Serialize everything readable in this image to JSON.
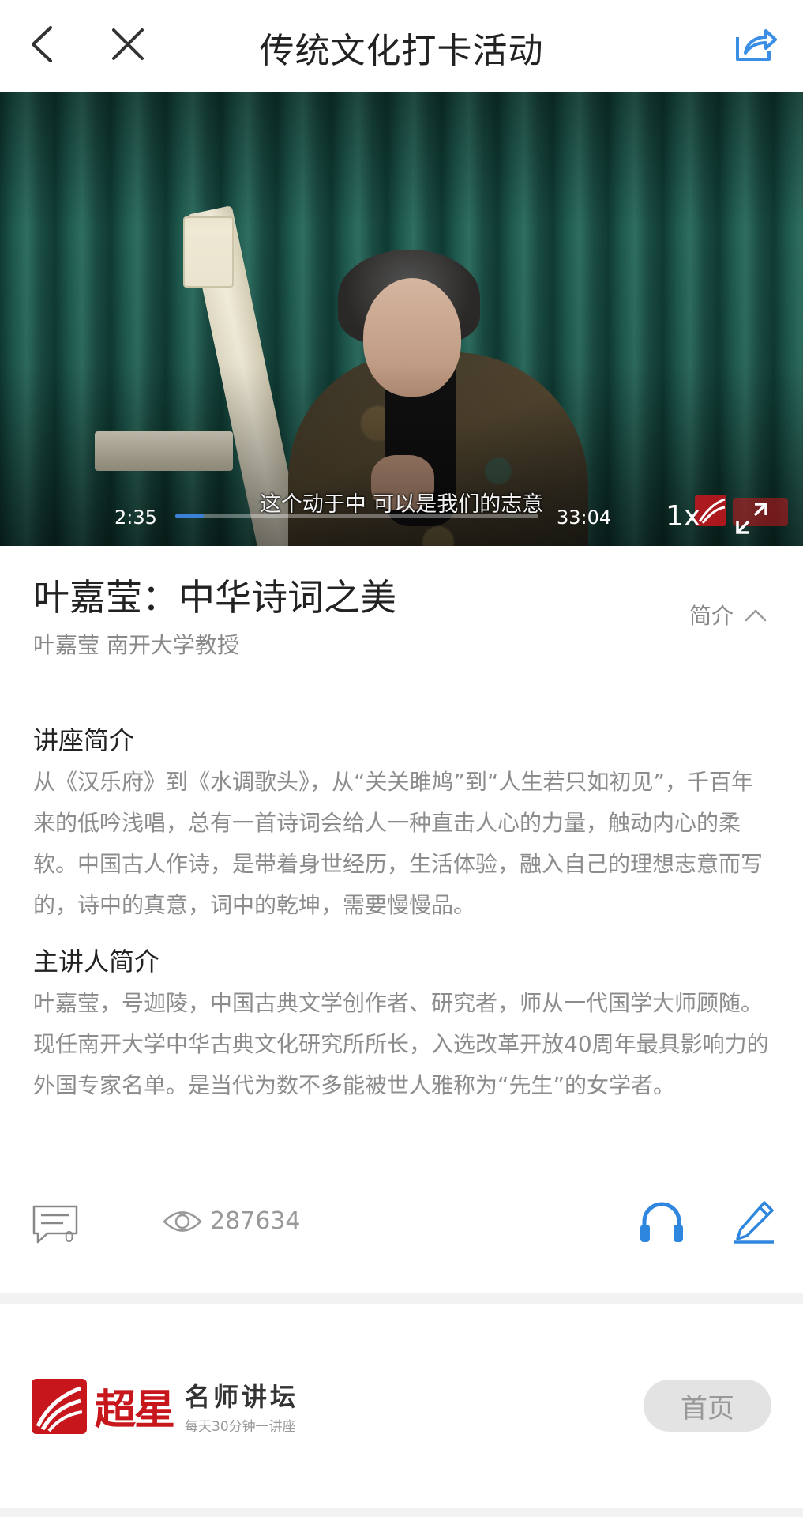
{
  "header": {
    "title": "传统文化打卡活动",
    "back_icon": "back-chevron-icon",
    "close_icon": "close-icon",
    "share_icon": "share-icon",
    "accent_color": "#3a8ee6"
  },
  "video": {
    "subtitle": "这个动于中  可以是我们的志意",
    "current_time": "2:35",
    "total_time": "33:04",
    "progress_fraction": 0.078,
    "speed": "1x",
    "fullscreen_icon": "fullscreen-icon"
  },
  "lecture": {
    "title": "叶嘉莹：中华诗词之美",
    "author": "叶嘉莹  南开大学教授",
    "intro_toggle_label": "简介"
  },
  "sections": {
    "lecture_intro_heading": "讲座简介",
    "lecture_intro_text": "从《汉乐府》到《水调歌头》，从“关关雎鸠”到“人生若只如初见”，千百年来的低吟浅唱，总有一首诗词会给人一种直击人心的力量，触动内心的柔软。中国古人作诗，是带着身世经历，生活体验，融入自己的理想志意而写的，诗中的真意，词中的乾坤，需要慢慢品。",
    "speaker_intro_heading": "主讲人简介",
    "speaker_intro_text": "叶嘉莹，号迦陵，中国古典文学创作者、研究者，师从一代国学大师顾随。现任南开大学中华古典文化研究所所长，入选改革开放40周年最具影响力的外国专家名单。是当代为数不多能被世人雅称为“先生”的女学者。"
  },
  "actions": {
    "comment_count": "0",
    "view_count": "287634",
    "icons": [
      "comment-icon",
      "eye-icon",
      "headphones-icon",
      "pencil-icon"
    ]
  },
  "footer": {
    "logo_word": "超星",
    "brand_name": "名师讲坛",
    "slogan": "每天30分钟一讲座",
    "home_button": "首页",
    "brand_color": "#c8161d"
  }
}
